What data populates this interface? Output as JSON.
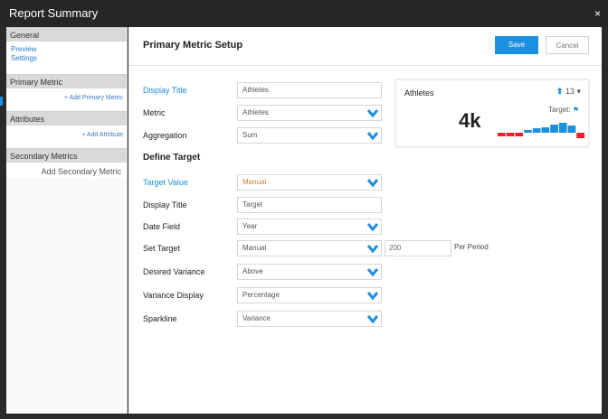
{
  "window": {
    "title": "Report Summary",
    "close_glyph": "×"
  },
  "sidebar": {
    "sections": [
      {
        "head": "General",
        "links": [
          "Preview",
          "Settings"
        ]
      },
      {
        "head": "Primary Metric",
        "action": "+ Add Primary Metric"
      },
      {
        "head": "Attributes",
        "action": "+ Add Attribute"
      },
      {
        "head": "Secondary Metrics",
        "action": "Add Secondary Metric"
      }
    ]
  },
  "main": {
    "title": "Primary Metric Setup",
    "save_label": "Save",
    "cancel_label": "Cancel"
  },
  "form": {
    "display_title": {
      "label": "Display Title",
      "value": "Athletes"
    },
    "metric": {
      "label": "Metric",
      "value": "Athletes"
    },
    "aggregation": {
      "label": "Aggregation",
      "value": "Sum"
    },
    "define_target": "Define Target",
    "target_value": {
      "label": "Target Value",
      "value": "Manual"
    },
    "display_title_2": {
      "label": "Display Title",
      "value": "Target"
    },
    "date_field": {
      "label": "Date Field",
      "value": "Year"
    },
    "set_target": {
      "label": "Set Target",
      "value": "Manual",
      "number": "200",
      "suffix": "Per Period"
    },
    "desired_variance": {
      "label": "Desired Variance",
      "value": "Above"
    },
    "variance_display": {
      "label": "Variance Display",
      "value": "Percentage"
    },
    "sparkline": {
      "label": "Sparkline",
      "value": "Variance"
    }
  },
  "widget": {
    "name": "Athletes",
    "trend_value": "13 ▾",
    "value": "4k",
    "target_label": "Target:",
    "target_flag": "⚑",
    "sparkline": {
      "baseline_fraction": 0.7,
      "bars": [
        {
          "v": -0.2,
          "color": "#e8232a"
        },
        {
          "v": -0.2,
          "color": "#e8232a"
        },
        {
          "v": -0.2,
          "color": "#e8232a"
        },
        {
          "v": 0.15,
          "color": "#1d8fe0"
        },
        {
          "v": 0.25,
          "color": "#1d8fe0"
        },
        {
          "v": 0.3,
          "color": "#1d8fe0"
        },
        {
          "v": 0.45,
          "color": "#1d8fe0"
        },
        {
          "v": 0.55,
          "color": "#1d8fe0"
        },
        {
          "v": 0.4,
          "color": "#1d8fe0"
        },
        {
          "v": -0.45,
          "color": "#e8232a"
        }
      ]
    }
  },
  "colors": {
    "accent": "#1d8fe0",
    "negative": "#e8232a",
    "orange": "#e07a2e"
  },
  "icons": {
    "dropdown": "chevron-down-icon",
    "trend": "arrow-up-icon",
    "target": "flag-icon"
  }
}
